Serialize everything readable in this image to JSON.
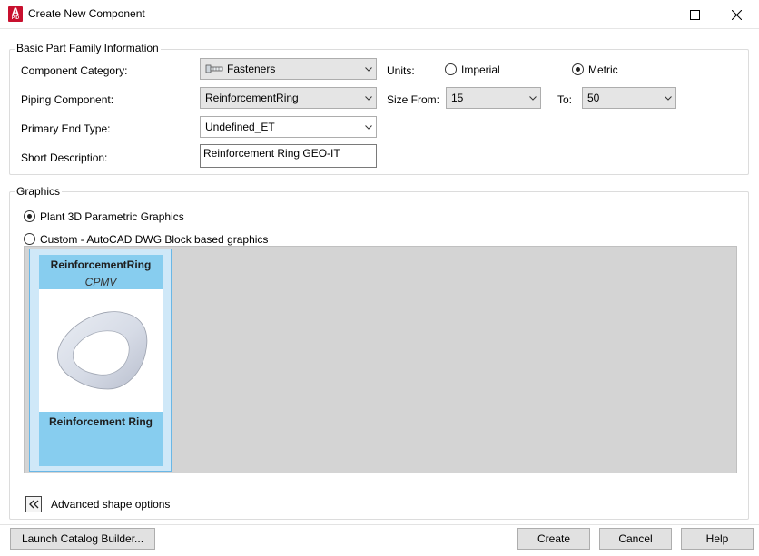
{
  "window": {
    "title": "Create New Component",
    "app_icon_letter": "A",
    "app_icon_sub": "PID"
  },
  "basic": {
    "group_label": "Basic Part Family Information",
    "category_label": "Component Category:",
    "category_value": "Fasteners",
    "piping_label": "Piping Component:",
    "piping_value": "ReinforcementRing",
    "end_type_label": "Primary End Type:",
    "end_type_value": "Undefined_ET",
    "short_desc_label": "Short Description:",
    "short_desc_value": "Reinforcement Ring GEO-IT",
    "units_label": "Units:",
    "unit_imperial": "Imperial",
    "unit_metric": "Metric",
    "selected_unit": "Metric",
    "size_from_label": "Size From:",
    "size_from_value": "15",
    "to_label": "To:",
    "size_to_value": "50"
  },
  "graphics": {
    "group_label": "Graphics",
    "option_parametric": "Plant 3D Parametric Graphics",
    "option_custom": "Custom - AutoCAD DWG Block based graphics",
    "selected_option": "parametric",
    "tile": {
      "name": "ReinforcementRing",
      "code": "CPMV",
      "caption": "Reinforcement Ring"
    }
  },
  "advanced_label": "Advanced shape options",
  "buttons": {
    "launch": "Launch Catalog Builder...",
    "create": "Create",
    "cancel": "Cancel",
    "help": "Help"
  },
  "colors": {
    "app_icon": "#c8102e",
    "tile_highlight": "#87cdef",
    "gallery_bg": "#d4d4d4"
  }
}
